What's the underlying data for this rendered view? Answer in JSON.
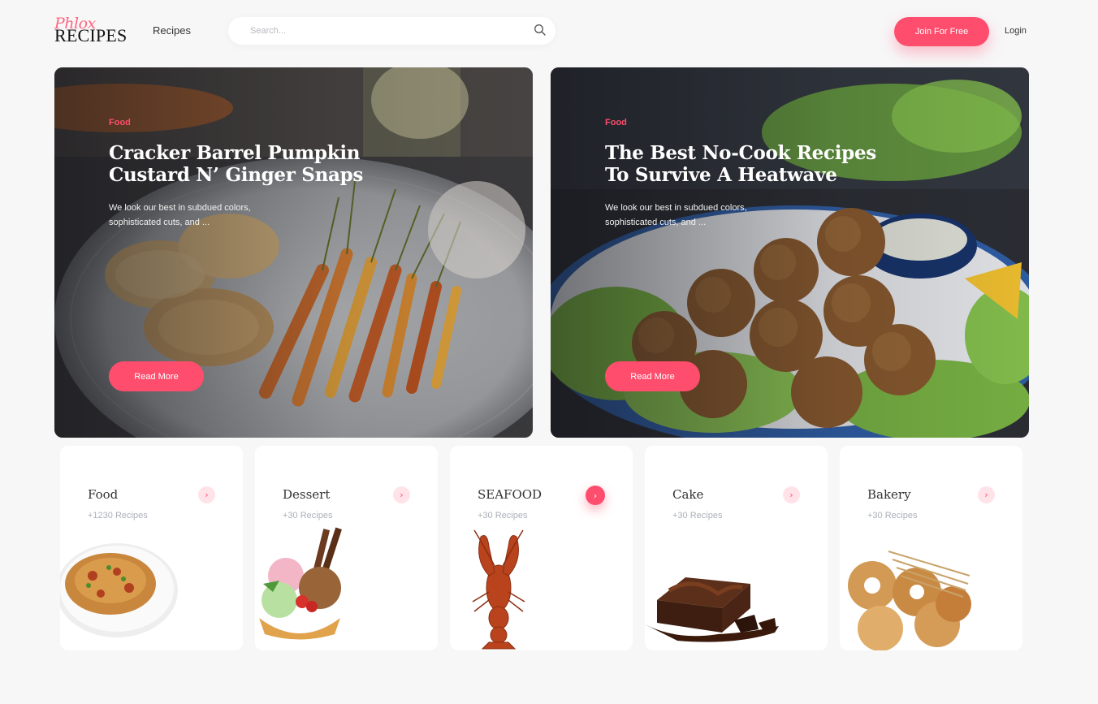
{
  "header": {
    "logo_script": "Phlox",
    "logo_main": "RECIPES",
    "nav_recipes": "Recipes",
    "search_placeholder": "Search...",
    "join_label": "Join For Free",
    "login_label": "Login"
  },
  "heroes": [
    {
      "tag": "Food",
      "title": "Cracker Barrel Pumpkin Custard N’ Ginger Snaps",
      "description": "We look our best in subdued colors, sophisticated cuts, and ...",
      "button": "Read More"
    },
    {
      "tag": "Food",
      "title": "The Best No-Cook Recipes To Survive A Heatwave",
      "description": "We look our best in subdued colors, sophisticated cuts, and ...",
      "button": "Read More"
    }
  ],
  "categories": [
    {
      "name": "Food",
      "count": "+1230 Recipes",
      "icon": "pasta-plate-image"
    },
    {
      "name": "Dessert",
      "count": "+30 Recipes",
      "icon": "ice-cream-image"
    },
    {
      "name": "SEAFOOD",
      "count": "+30 Recipes",
      "icon": "lobster-image",
      "active": true
    },
    {
      "name": "Cake",
      "count": "+30 Recipes",
      "icon": "brownie-image"
    },
    {
      "name": "Bakery",
      "count": "+30 Recipes",
      "icon": "bread-image"
    }
  ],
  "colors": {
    "accent": "#ff4d6d",
    "accent_soft": "#ffe3e8",
    "background": "#f7f7f8"
  }
}
